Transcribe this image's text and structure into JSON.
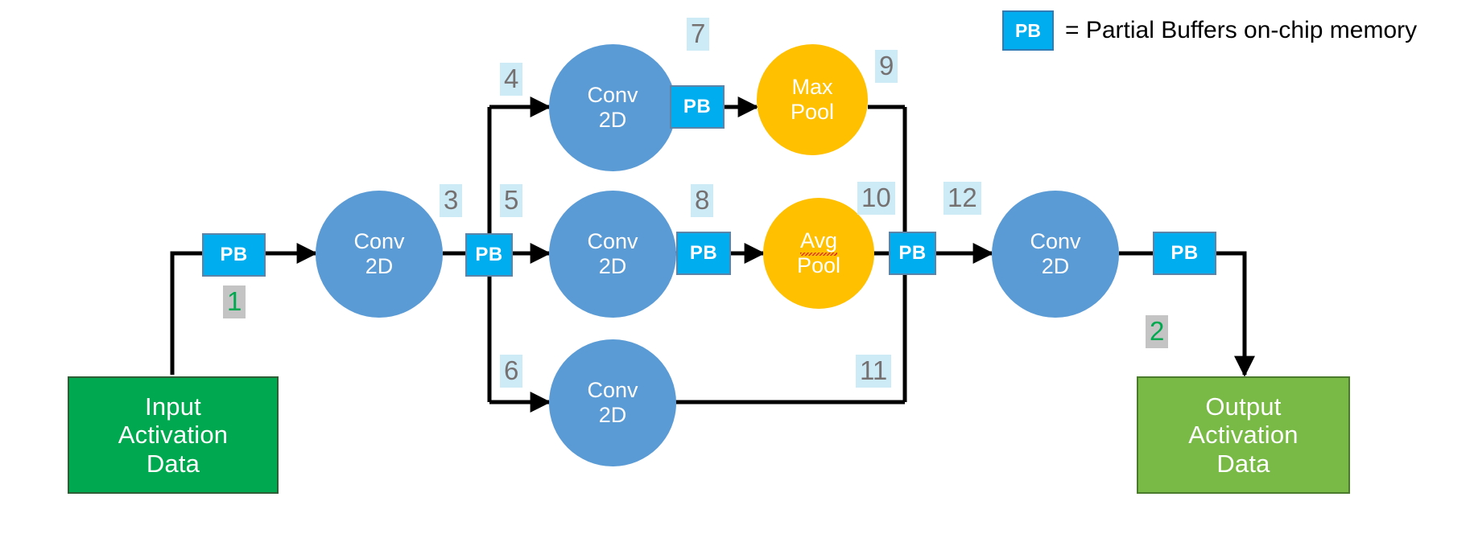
{
  "diagram": {
    "title": "Partial Buffers CNN dataflow diagram",
    "colors": {
      "input_box": "#00A94F",
      "output_box": "#79b945",
      "conv_circle": "#5B9BD5",
      "pool_circle": "#FFC000",
      "pb_box": "#00AEEF",
      "pb_border": "#5b84a8",
      "edge": "#000000",
      "label_blue_bg": "#CDEAF7",
      "label_blue_text": "#767171",
      "label_green_bg": "#C4C4C4",
      "label_green_text": "#00A94F"
    }
  },
  "legend": {
    "swatch_label": "PB",
    "text": "= Partial Buffers on-chip memory"
  },
  "nodes": {
    "input_data": {
      "label": "Input\nActivation\nData",
      "shape": "rect",
      "kind": "data"
    },
    "output_data": {
      "label": "Output\nActivation\nData",
      "shape": "rect",
      "kind": "data"
    },
    "pb_in": {
      "label": "PB",
      "shape": "rect",
      "kind": "buffer"
    },
    "conv_stem": {
      "label": "Conv\n2D",
      "shape": "circle",
      "kind": "conv"
    },
    "pb_split": {
      "label": "PB",
      "shape": "rect",
      "kind": "buffer"
    },
    "conv_top": {
      "label": "Conv\n2D",
      "shape": "circle",
      "kind": "conv"
    },
    "conv_mid": {
      "label": "Conv\n2D",
      "shape": "circle",
      "kind": "conv"
    },
    "conv_bot": {
      "label": "Conv\n2D",
      "shape": "circle",
      "kind": "conv"
    },
    "pb_top": {
      "label": "PB",
      "shape": "rect",
      "kind": "buffer"
    },
    "pb_mid": {
      "label": "PB",
      "shape": "rect",
      "kind": "buffer"
    },
    "max_pool": {
      "label_line1": "Max",
      "label_line2": "Pool",
      "shape": "circle",
      "kind": "pool"
    },
    "avg_pool": {
      "label_line1": "Avg",
      "label_line2": "Pool",
      "shape": "circle",
      "kind": "pool",
      "spellcheck_underline_on": "Avg"
    },
    "pb_merge": {
      "label": "PB",
      "shape": "rect",
      "kind": "buffer"
    },
    "conv_out": {
      "label": "Conv\n2D",
      "shape": "circle",
      "kind": "conv"
    },
    "pb_out": {
      "label": "PB",
      "shape": "rect",
      "kind": "buffer"
    }
  },
  "edge_labels": [
    {
      "id": "l1",
      "text": "1",
      "style": "green"
    },
    {
      "id": "l2",
      "text": "2",
      "style": "green"
    },
    {
      "id": "l3",
      "text": "3",
      "style": "blue"
    },
    {
      "id": "l4",
      "text": "4",
      "style": "blue"
    },
    {
      "id": "l5",
      "text": "5",
      "style": "blue"
    },
    {
      "id": "l6",
      "text": "6",
      "style": "blue"
    },
    {
      "id": "l7",
      "text": "7",
      "style": "blue"
    },
    {
      "id": "l8",
      "text": "8",
      "style": "blue"
    },
    {
      "id": "l9",
      "text": "9",
      "style": "blue"
    },
    {
      "id": "l10",
      "text": "10",
      "style": "blue"
    },
    {
      "id": "l11",
      "text": "11",
      "style": "blue"
    },
    {
      "id": "l12",
      "text": "12",
      "style": "blue"
    }
  ]
}
